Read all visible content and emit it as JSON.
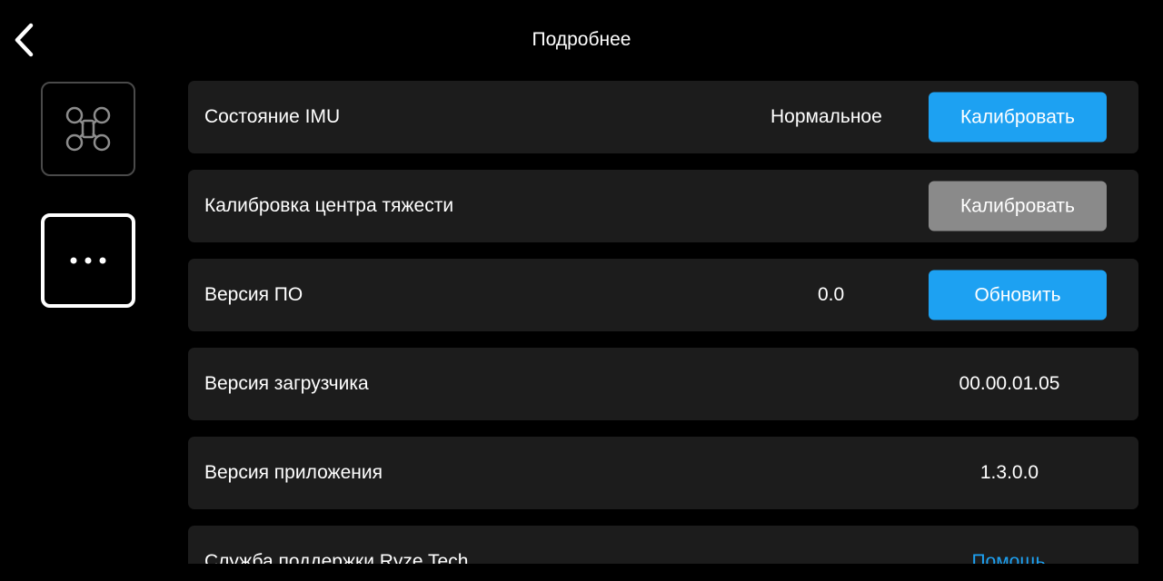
{
  "header": {
    "title": "Подробнее",
    "back_icon": "chevron-left-icon"
  },
  "sidebar": {
    "tabs": [
      {
        "name": "drone",
        "icon": "drone-icon",
        "selected": false
      },
      {
        "name": "more",
        "icon": "more-icon",
        "selected": true
      }
    ]
  },
  "colors": {
    "accent": "#1da1f2",
    "disabled_button": "#8a8a8a",
    "row_background": "#1c1c1c",
    "background": "#000000"
  },
  "rows": {
    "imu": {
      "label": "Состояние IMU",
      "status": "Нормальное",
      "button": "Калибровать"
    },
    "gravity": {
      "label": "Калибровка центра тяжести",
      "button": "Калибровать"
    },
    "firmware": {
      "label": "Версия ПО",
      "value": "0.0",
      "button": "Обновить"
    },
    "bootloader": {
      "label": "Версия загрузчика",
      "value": "00.00.01.05"
    },
    "app": {
      "label": "Версия приложения",
      "value": "1.3.0.0"
    },
    "support": {
      "label": "Служба поддержки Ryze Tech",
      "link": "Помощь"
    }
  }
}
